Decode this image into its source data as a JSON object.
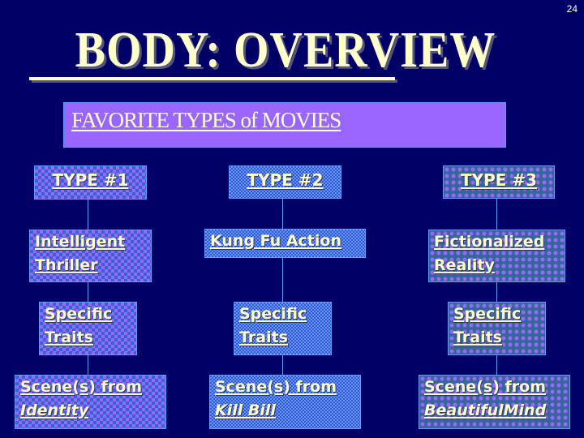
{
  "slide": {
    "page_number": "24",
    "title": "BODY:  OVERVIEW",
    "banner": "FAVORITE TYPES of MOVIES"
  },
  "columns": [
    {
      "header": "TYPE #1",
      "genre": [
        "Intelligent",
        "Thriller"
      ],
      "traits": [
        "Specific",
        "Traits"
      ],
      "scenes_label": "Scene(s) from",
      "movie": "Identity"
    },
    {
      "header": "TYPE #2",
      "genre": [
        "Kung Fu Action"
      ],
      "traits": [
        "Specific",
        "Traits"
      ],
      "scenes_label": "Scene(s) from",
      "movie": "Kill Bill"
    },
    {
      "header": "TYPE #3",
      "genre": [
        "Fictionalized",
        "Reality"
      ],
      "traits": [
        "Specific",
        "Traits"
      ],
      "scenes_label": "Scene(s) from",
      "movie": "BeautifulMind"
    }
  ],
  "colors": {
    "background": "#000066",
    "text": "#ffffcc",
    "banner": "#9966ff",
    "connector": "#6699ff"
  }
}
